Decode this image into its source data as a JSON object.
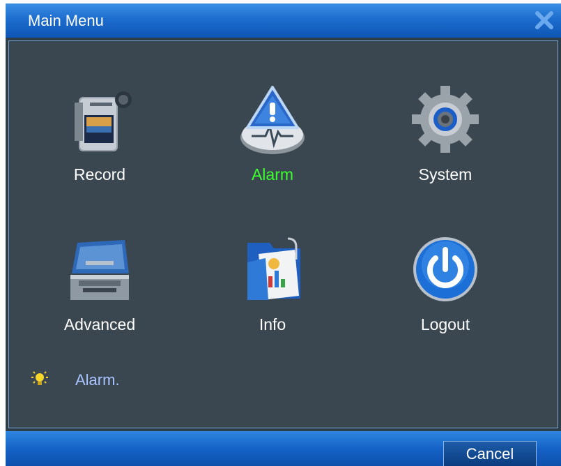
{
  "window": {
    "title": "Main Menu"
  },
  "menu": {
    "items": [
      {
        "label": "Record",
        "icon": "video-camera-icon"
      },
      {
        "label": "Alarm",
        "icon": "alarm-warning-icon",
        "selected": true
      },
      {
        "label": "System",
        "icon": "gear-icon"
      },
      {
        "label": "Advanced",
        "icon": "toolbox-icon"
      },
      {
        "label": "Info",
        "icon": "folder-info-icon"
      },
      {
        "label": "Logout",
        "icon": "power-icon"
      }
    ]
  },
  "hint": {
    "text": "Alarm.",
    "icon": "lightbulb-icon"
  },
  "footer": {
    "cancel_label": "Cancel"
  },
  "colors": {
    "selected_label": "#3cff2e",
    "hint_text": "#a9c4ff",
    "title_bar": "#1d6dce"
  }
}
